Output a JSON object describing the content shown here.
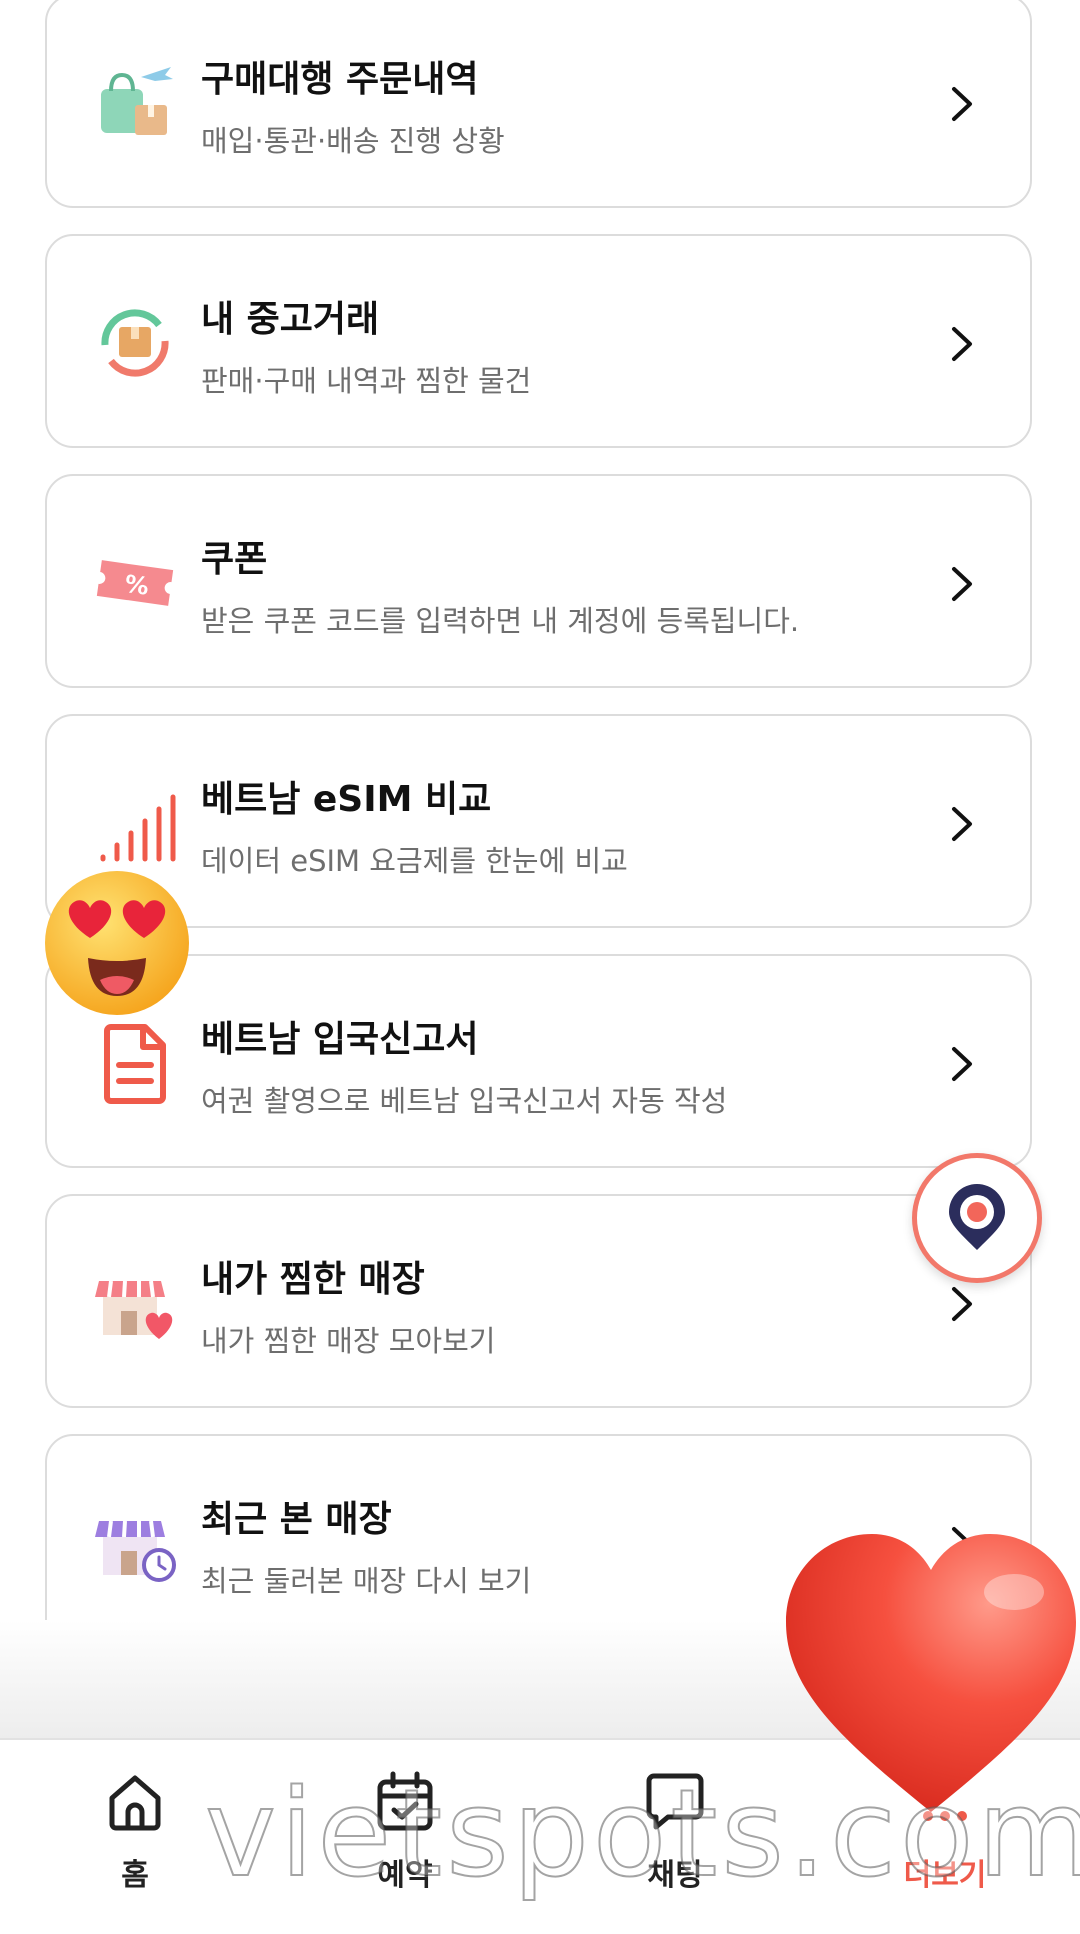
{
  "menu": {
    "items": [
      {
        "title": "구매대행 주문내역",
        "subtitle": "매입·통관·배송 진행 상황",
        "icon": "shopping-bag-icon"
      },
      {
        "title": "내 중고거래",
        "subtitle": "판매·구매 내역과 찜한 물건",
        "icon": "box-exchange-icon"
      },
      {
        "title": "쿠폰",
        "subtitle": "받은 쿠폰 코드를 입력하면 내 계정에 등록됩니다.",
        "icon": "coupon-icon"
      },
      {
        "title": "베트남 eSIM 비교",
        "subtitle": "데이터 eSIM 요금제를 한눈에 비교",
        "icon": "signal-icon"
      },
      {
        "title": "베트남 입국신고서",
        "subtitle": "여권 촬영으로 베트남 입국신고서 자동 작성",
        "icon": "document-icon"
      },
      {
        "title": "내가 찜한 매장",
        "subtitle": "내가 찜한 매장 모아보기",
        "icon": "store-heart-icon"
      },
      {
        "title": "최근 본 매장",
        "subtitle": "최근 둘러본 매장 다시 보기",
        "icon": "store-clock-icon"
      }
    ]
  },
  "nav": {
    "items": [
      {
        "label": "홈",
        "icon": "home-icon"
      },
      {
        "label": "예약",
        "icon": "calendar-icon"
      },
      {
        "label": "채팅",
        "icon": "chat-icon"
      },
      {
        "label": "더보기",
        "icon": "more-icon",
        "active": true
      }
    ]
  },
  "watermark": "vietspots.com",
  "colors": {
    "accent": "#ef5a4a",
    "fab_ring": "#f2786a",
    "pin": "#2b2d5c"
  }
}
